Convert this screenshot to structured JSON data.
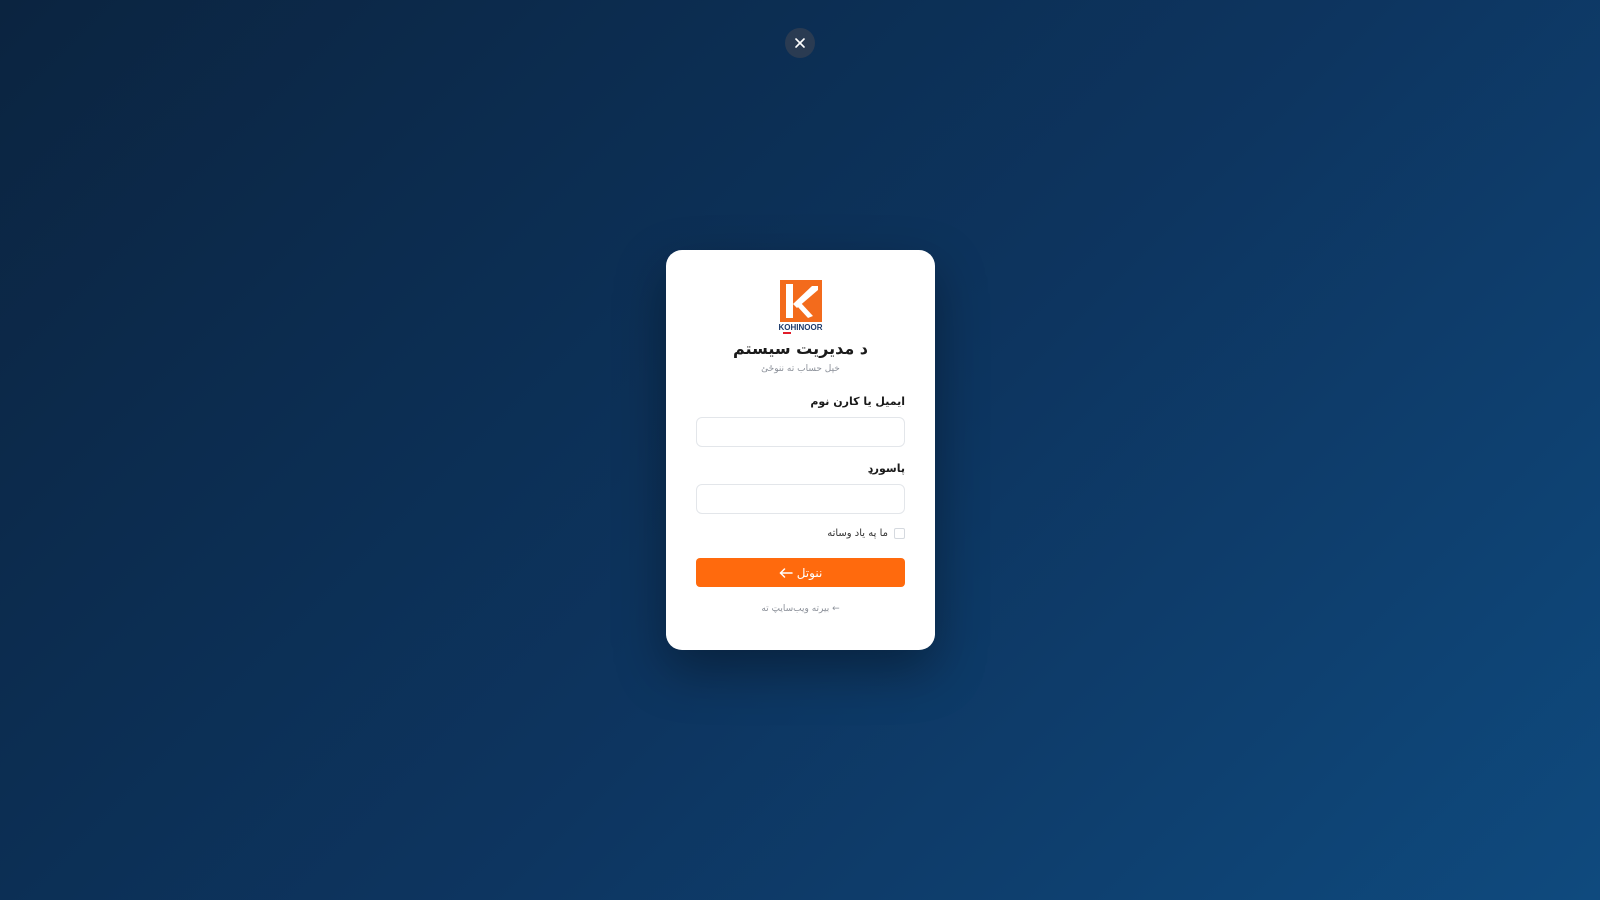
{
  "close": {
    "icon": "close-icon"
  },
  "logo": {
    "brand_text": "KOHINOOR"
  },
  "card": {
    "title": "د مدیریت سیستم",
    "subtitle": "خپل حساب ته ننوځئ"
  },
  "form": {
    "email_label": "ایمیل یا کارن نوم",
    "email_value": "",
    "email_placeholder": "",
    "password_label": "پاسورډ",
    "password_value": "",
    "password_placeholder": "",
    "remember_label": "ما په یاد وساته",
    "remember_checked": false,
    "submit_label": "ننوتل",
    "submit_icon": "arrow-left-icon",
    "back_link": "← بیرته ویب‌سایټ ته"
  },
  "colors": {
    "accent": "#ff6a0d",
    "logo_orange": "#f36b1c",
    "background_from": "#0b2440",
    "background_to": "#0f4a7e"
  }
}
